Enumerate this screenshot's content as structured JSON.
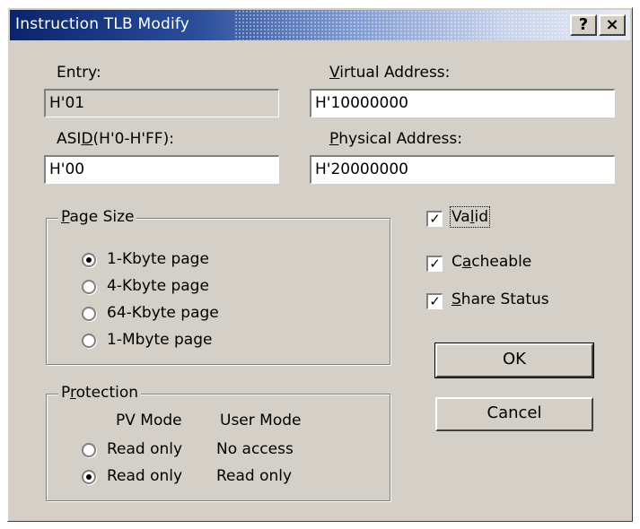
{
  "window": {
    "title": "Instruction TLB Modify",
    "help_button": "?",
    "close_button": "×"
  },
  "fields": {
    "entry": {
      "label": "Entry:",
      "value": "H'01"
    },
    "virtual_address": {
      "label_accel": "V",
      "label_rest": "irtual Address:",
      "value": "H'10000000"
    },
    "asid": {
      "label_pre": "ASI",
      "label_accel": "D",
      "label_post": "(H'0-H'FF):",
      "value": "H'00"
    },
    "physical_address": {
      "label_accel": "P",
      "label_rest": "hysical Address:",
      "value": "H'20000000"
    }
  },
  "page_size": {
    "title_accel": "P",
    "title_rest": "age Size",
    "options": [
      {
        "label": "1-Kbyte page",
        "checked": true
      },
      {
        "label": "4-Kbyte page",
        "checked": false
      },
      {
        "label": "64-Kbyte page",
        "checked": false
      },
      {
        "label": "1-Mbyte page",
        "checked": false
      }
    ]
  },
  "protection": {
    "title_pre": "P",
    "title_accel": "r",
    "title_post": "otection",
    "col_pv": "PV Mode",
    "col_user": "User Mode",
    "rows": [
      {
        "pv": "Read only",
        "user": "No access",
        "checked": false
      },
      {
        "pv": "Read only",
        "user": "Read only",
        "checked": true
      }
    ]
  },
  "checkboxes": {
    "valid": {
      "pre": "Va",
      "accel": "l",
      "post": "id",
      "checked": true,
      "mark": "✓"
    },
    "cacheable": {
      "pre": "C",
      "accel": "a",
      "post": "cheable",
      "checked": true,
      "mark": "✓"
    },
    "share_status": {
      "pre": "",
      "accel": "S",
      "post": "hare Status",
      "checked": true,
      "mark": "✓"
    }
  },
  "buttons": {
    "ok": "OK",
    "cancel": "Cancel"
  }
}
